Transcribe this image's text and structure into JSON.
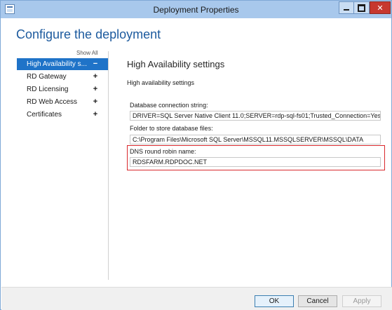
{
  "window": {
    "title": "Deployment Properties",
    "accent": "#1f73c8",
    "highlight_color": "#d9282c"
  },
  "page": {
    "title": "Configure the deployment"
  },
  "nav": {
    "show_all": "Show All",
    "items": [
      {
        "label": "High Availability s...",
        "toggle": "−",
        "selected": true
      },
      {
        "label": "RD Gateway",
        "toggle": "+"
      },
      {
        "label": "RD Licensing",
        "toggle": "+"
      },
      {
        "label": "RD Web Access",
        "toggle": "+"
      },
      {
        "label": "Certificates",
        "toggle": "+"
      }
    ]
  },
  "settings": {
    "section_title": "High Availability settings",
    "subsection_title": "High availability settings",
    "db_connection": {
      "label": "Database connection string:",
      "value": "DRIVER=SQL Server Native Client 11.0;SERVER=rdp-sql-fs01;Trusted_Connection=Yes;APP"
    },
    "db_folder": {
      "label": "Folder to store database files:",
      "value": "C:\\Program Files\\Microsoft SQL Server\\MSSQL11.MSSQLSERVER\\MSSQL\\DATA"
    },
    "dns_rr": {
      "label": "DNS round robin name:",
      "value": "RDSFARM.RDPDOC.NET"
    }
  },
  "footer": {
    "ok": "OK",
    "cancel": "Cancel",
    "apply": "Apply"
  }
}
